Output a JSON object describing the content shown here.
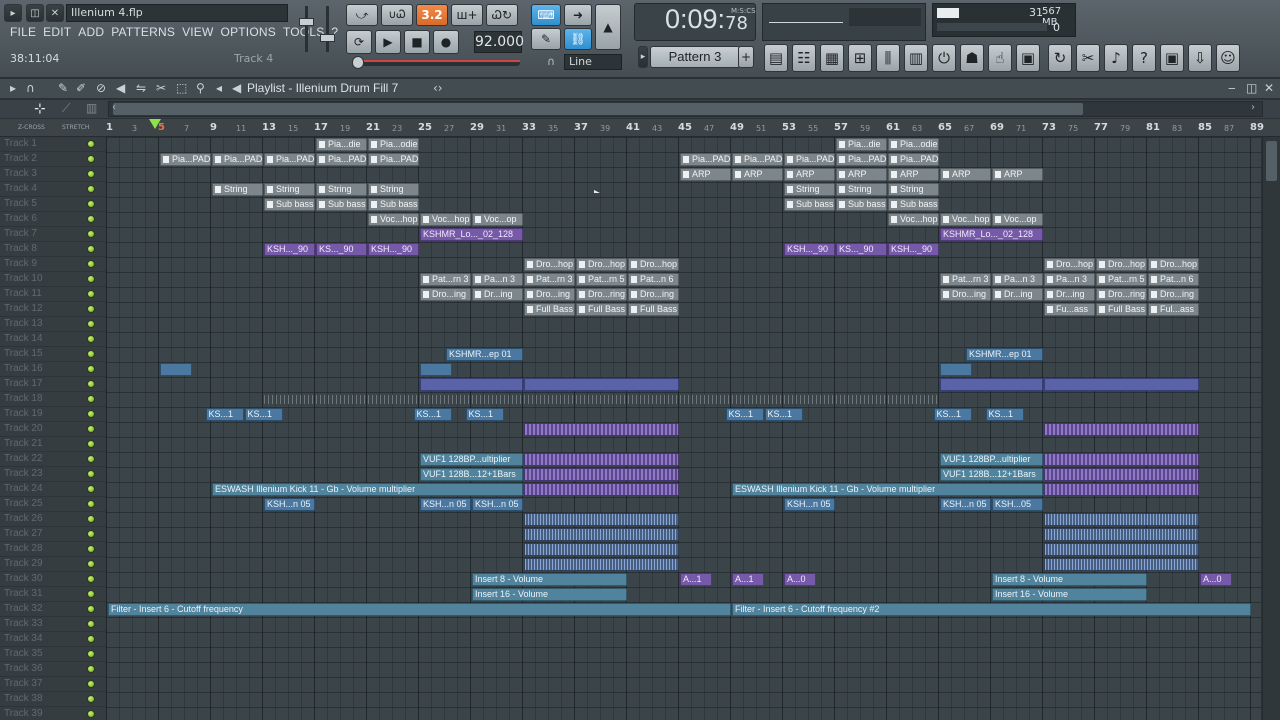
{
  "file_title": "Illenium 4.flp",
  "menu": [
    "FILE",
    "EDIT",
    "ADD",
    "PATTERNS",
    "VIEW",
    "OPTIONS",
    "TOOLS",
    "?"
  ],
  "hint_time": "38:11:04",
  "hint_text": "Track 4",
  "transport": {
    "time_big": "0:09:",
    "time_small": "78",
    "time_unit": "M:S:CS",
    "tempo": "92.000",
    "pattern": "Pattern 3",
    "snap": "Line"
  },
  "cpu": {
    "value": "31",
    "mem": "567 MB",
    "polyphony": "0"
  },
  "playlist": {
    "title": "Playlist - Illenium Drum Fill 7"
  },
  "ruler_labels": [
    "1",
    "3",
    "5",
    "7",
    "9",
    "11",
    "13",
    "15",
    "17",
    "19",
    "21",
    "23",
    "25",
    "27",
    "29",
    "31",
    "33",
    "35",
    "37",
    "39",
    "41",
    "43",
    "45",
    "47",
    "49",
    "51",
    "53",
    "55",
    "57",
    "59",
    "61",
    "63",
    "65",
    "67",
    "69",
    "71",
    "73",
    "75",
    "77",
    "79",
    "81",
    "83",
    "85",
    "87",
    "89"
  ],
  "zcross_label": "Z-CROSS",
  "stretch_label": "STRETCH",
  "tracks": [
    "Track 1",
    "Track 2",
    "Track 3",
    "Track 4",
    "Track 5",
    "Track 6",
    "Track 7",
    "Track 8",
    "Track 9",
    "Track 10",
    "Track 11",
    "Track 12",
    "Track 13",
    "Track 14",
    "Track 15",
    "Track 16",
    "Track 17",
    "Track 18",
    "Track 19",
    "Track 20",
    "Track 21",
    "Track 22",
    "Track 23",
    "Track 24",
    "Track 25",
    "Track 26",
    "Track 27",
    "Track 28",
    "Track 29",
    "Track 30",
    "Track 31",
    "Track 32",
    "Track 33",
    "Track 34",
    "Track 35",
    "Track 36",
    "Track 37",
    "Track 38",
    "Track 39"
  ],
  "clips": [
    {
      "track": 1,
      "bar": 17,
      "len": 4,
      "label": "Pia...die",
      "style": "g"
    },
    {
      "track": 1,
      "bar": 21,
      "len": 4,
      "label": "Pia...odie",
      "style": "g"
    },
    {
      "track": 1,
      "bar": 57,
      "len": 4,
      "label": "Pia...die",
      "style": "g"
    },
    {
      "track": 1,
      "bar": 61,
      "len": 4,
      "label": "Pia...odie",
      "style": "g"
    },
    {
      "track": 2,
      "bar": 5,
      "len": 4,
      "label": "Pia...PAD",
      "style": "g"
    },
    {
      "track": 2,
      "bar": 9,
      "len": 4,
      "label": "Pia...PAD",
      "style": "g"
    },
    {
      "track": 2,
      "bar": 13,
      "len": 4,
      "label": "Pia...PAD",
      "style": "g"
    },
    {
      "track": 2,
      "bar": 17,
      "len": 4,
      "label": "Pia...PAD",
      "style": "g"
    },
    {
      "track": 2,
      "bar": 21,
      "len": 4,
      "label": "Pia...PAD",
      "style": "g"
    },
    {
      "track": 2,
      "bar": 45,
      "len": 4,
      "label": "Pia...PAD",
      "style": "g"
    },
    {
      "track": 2,
      "bar": 49,
      "len": 4,
      "label": "Pia...PAD",
      "style": "g"
    },
    {
      "track": 2,
      "bar": 53,
      "len": 4,
      "label": "Pia...PAD",
      "style": "g"
    },
    {
      "track": 2,
      "bar": 57,
      "len": 4,
      "label": "Pia...PAD",
      "style": "g"
    },
    {
      "track": 2,
      "bar": 61,
      "len": 4,
      "label": "Pia...PAD",
      "style": "g"
    },
    {
      "track": 3,
      "bar": 45,
      "len": 4,
      "label": "ARP",
      "style": "g"
    },
    {
      "track": 3,
      "bar": 49,
      "len": 4,
      "label": "ARP",
      "style": "g"
    },
    {
      "track": 3,
      "bar": 53,
      "len": 4,
      "label": "ARP",
      "style": "g"
    },
    {
      "track": 3,
      "bar": 57,
      "len": 4,
      "label": "ARP",
      "style": "g"
    },
    {
      "track": 3,
      "bar": 61,
      "len": 4,
      "label": "ARP",
      "style": "g"
    },
    {
      "track": 3,
      "bar": 65,
      "len": 4,
      "label": "ARP",
      "style": "g"
    },
    {
      "track": 3,
      "bar": 69,
      "len": 4,
      "label": "ARP",
      "style": "g"
    },
    {
      "track": 4,
      "bar": 9,
      "len": 4,
      "label": "String",
      "style": "g"
    },
    {
      "track": 4,
      "bar": 13,
      "len": 4,
      "label": "String",
      "style": "g"
    },
    {
      "track": 4,
      "bar": 17,
      "len": 4,
      "label": "String",
      "style": "g"
    },
    {
      "track": 4,
      "bar": 21,
      "len": 4,
      "label": "String",
      "style": "g"
    },
    {
      "track": 4,
      "bar": 53,
      "len": 4,
      "label": "String",
      "style": "g"
    },
    {
      "track": 4,
      "bar": 57,
      "len": 4,
      "label": "String",
      "style": "g"
    },
    {
      "track": 4,
      "bar": 61,
      "len": 4,
      "label": "String",
      "style": "g"
    },
    {
      "track": 5,
      "bar": 13,
      "len": 4,
      "label": "Sub bass",
      "style": "g"
    },
    {
      "track": 5,
      "bar": 17,
      "len": 4,
      "label": "Sub bass",
      "style": "g"
    },
    {
      "track": 5,
      "bar": 21,
      "len": 4,
      "label": "Sub bass",
      "style": "g"
    },
    {
      "track": 5,
      "bar": 53,
      "len": 4,
      "label": "Sub bass",
      "style": "g"
    },
    {
      "track": 5,
      "bar": 57,
      "len": 4,
      "label": "Sub bass",
      "style": "g"
    },
    {
      "track": 5,
      "bar": 61,
      "len": 4,
      "label": "Sub bass",
      "style": "g"
    },
    {
      "track": 6,
      "bar": 21,
      "len": 4,
      "label": "Voc...hop",
      "style": "g"
    },
    {
      "track": 6,
      "bar": 25,
      "len": 4,
      "label": "Voc...hop",
      "style": "g"
    },
    {
      "track": 6,
      "bar": 29,
      "len": 4,
      "label": "Voc...op",
      "style": "g"
    },
    {
      "track": 6,
      "bar": 61,
      "len": 4,
      "label": "Voc...hop",
      "style": "g"
    },
    {
      "track": 6,
      "bar": 65,
      "len": 4,
      "label": "Voc...hop",
      "style": "g"
    },
    {
      "track": 6,
      "bar": 69,
      "len": 4,
      "label": "Voc...op",
      "style": "g"
    },
    {
      "track": 7,
      "bar": 25,
      "len": 8,
      "label": "KSHMR_Lo..._02_128",
      "style": "p"
    },
    {
      "track": 7,
      "bar": 65,
      "len": 8,
      "label": "KSHMR_Lo..._02_128",
      "style": "p"
    },
    {
      "track": 8,
      "bar": 13,
      "len": 4,
      "label": "KSH..._90",
      "style": "p"
    },
    {
      "track": 8,
      "bar": 17,
      "len": 4,
      "label": "KS..._90",
      "style": "p"
    },
    {
      "track": 8,
      "bar": 21,
      "len": 4,
      "label": "KSH..._90",
      "style": "p"
    },
    {
      "track": 8,
      "bar": 53,
      "len": 4,
      "label": "KSH..._90",
      "style": "p"
    },
    {
      "track": 8,
      "bar": 57,
      "len": 4,
      "label": "KS..._90",
      "style": "p"
    },
    {
      "track": 8,
      "bar": 61,
      "len": 4,
      "label": "KSH..._90",
      "style": "p"
    },
    {
      "track": 9,
      "bar": 33,
      "len": 4,
      "label": "Dro...hop",
      "style": "g"
    },
    {
      "track": 9,
      "bar": 37,
      "len": 4,
      "label": "Dro...hop",
      "style": "g"
    },
    {
      "track": 9,
      "bar": 41,
      "len": 4,
      "label": "Dro...hop",
      "style": "g"
    },
    {
      "track": 9,
      "bar": 73,
      "len": 4,
      "label": "Dro...hop",
      "style": "g"
    },
    {
      "track": 9,
      "bar": 77,
      "len": 4,
      "label": "Dro...hop",
      "style": "g"
    },
    {
      "track": 9,
      "bar": 81,
      "len": 4,
      "label": "Dro...hop",
      "style": "g"
    },
    {
      "track": 10,
      "bar": 25,
      "len": 4,
      "label": "Pat...rn 3",
      "style": "g"
    },
    {
      "track": 10,
      "bar": 29,
      "len": 4,
      "label": "Pa...n 3",
      "style": "g"
    },
    {
      "track": 10,
      "bar": 33,
      "len": 4,
      "label": "Pat...rn 3",
      "style": "g"
    },
    {
      "track": 10,
      "bar": 37,
      "len": 4,
      "label": "Pat...rn 5",
      "style": "g"
    },
    {
      "track": 10,
      "bar": 41,
      "len": 4,
      "label": "Pat...n 6",
      "style": "g"
    },
    {
      "track": 10,
      "bar": 65,
      "len": 4,
      "label": "Pat...rn 3",
      "style": "g"
    },
    {
      "track": 10,
      "bar": 69,
      "len": 4,
      "label": "Pa...n 3",
      "style": "g"
    },
    {
      "track": 10,
      "bar": 73,
      "len": 4,
      "label": "Pa...n 3",
      "style": "g"
    },
    {
      "track": 10,
      "bar": 77,
      "len": 4,
      "label": "Pat...rn 5",
      "style": "g"
    },
    {
      "track": 10,
      "bar": 81,
      "len": 4,
      "label": "Pat...n 6",
      "style": "g"
    },
    {
      "track": 11,
      "bar": 25,
      "len": 4,
      "label": "Dro...ing",
      "style": "g"
    },
    {
      "track": 11,
      "bar": 29,
      "len": 4,
      "label": "Dr...ing",
      "style": "g"
    },
    {
      "track": 11,
      "bar": 33,
      "len": 4,
      "label": "Dro...ing",
      "style": "g"
    },
    {
      "track": 11,
      "bar": 37,
      "len": 4,
      "label": "Dro...ring",
      "style": "g"
    },
    {
      "track": 11,
      "bar": 41,
      "len": 4,
      "label": "Dro...ing",
      "style": "g"
    },
    {
      "track": 11,
      "bar": 65,
      "len": 4,
      "label": "Dro...ing",
      "style": "g"
    },
    {
      "track": 11,
      "bar": 69,
      "len": 4,
      "label": "Dr...ing",
      "style": "g"
    },
    {
      "track": 11,
      "bar": 73,
      "len": 4,
      "label": "Dr...ing",
      "style": "g"
    },
    {
      "track": 11,
      "bar": 77,
      "len": 4,
      "label": "Dro...ring",
      "style": "g"
    },
    {
      "track": 11,
      "bar": 81,
      "len": 4,
      "label": "Dro...ing",
      "style": "g"
    },
    {
      "track": 12,
      "bar": 33,
      "len": 4,
      "label": "Full Bass",
      "style": "g"
    },
    {
      "track": 12,
      "bar": 37,
      "len": 4,
      "label": "Full Bass",
      "style": "g"
    },
    {
      "track": 12,
      "bar": 41,
      "len": 4,
      "label": "Full Bass",
      "style": "g"
    },
    {
      "track": 12,
      "bar": 73,
      "len": 4,
      "label": "Fu...ass",
      "style": "g"
    },
    {
      "track": 12,
      "bar": 77,
      "len": 4,
      "label": "Full Bass",
      "style": "g"
    },
    {
      "track": 12,
      "bar": 81,
      "len": 4,
      "label": "Ful...ass",
      "style": "g"
    },
    {
      "track": 15,
      "bar": 27,
      "len": 6,
      "label": "KSHMR...ep 01",
      "style": "b"
    },
    {
      "track": 15,
      "bar": 67,
      "len": 6,
      "label": "KSHMR...ep 01",
      "style": "b"
    },
    {
      "track": 16,
      "bar": 5,
      "len": 2.5,
      "label": "",
      "style": "b"
    },
    {
      "track": 16,
      "bar": 25,
      "len": 2.5,
      "label": "",
      "style": "b"
    },
    {
      "track": 16,
      "bar": 65,
      "len": 2.5,
      "label": "",
      "style": "b"
    },
    {
      "track": 17,
      "bar": 25,
      "len": 8,
      "label": "",
      "style": "bp"
    },
    {
      "track": 17,
      "bar": 33,
      "len": 12,
      "label": "",
      "style": "bp"
    },
    {
      "track": 17,
      "bar": 65,
      "len": 8,
      "label": "",
      "style": "bp"
    },
    {
      "track": 17,
      "bar": 73,
      "len": 12,
      "label": "",
      "style": "bp"
    },
    {
      "track": 18,
      "bar": 13,
      "len": 52,
      "label": "",
      "style": "ticks"
    },
    {
      "track": 19,
      "bar": 8.5,
      "len": 3,
      "label": "KS...1",
      "style": "b"
    },
    {
      "track": 19,
      "bar": 11.5,
      "len": 3,
      "label": "KS...1",
      "style": "b"
    },
    {
      "track": 19,
      "bar": 24.5,
      "len": 3,
      "label": "KS...1",
      "style": "b"
    },
    {
      "track": 19,
      "bar": 28.5,
      "len": 3,
      "label": "KS...1",
      "style": "b"
    },
    {
      "track": 19,
      "bar": 48.5,
      "len": 3,
      "label": "KS...1",
      "style": "b"
    },
    {
      "track": 19,
      "bar": 51.5,
      "len": 3,
      "label": "KS...1",
      "style": "b"
    },
    {
      "track": 19,
      "bar": 64.5,
      "len": 3,
      "label": "KS...1",
      "style": "b"
    },
    {
      "track": 19,
      "bar": 68.5,
      "len": 3,
      "label": "KS...1",
      "style": "b"
    },
    {
      "track": 20,
      "bar": 33,
      "len": 12,
      "label": "",
      "style": "dense"
    },
    {
      "track": 20,
      "bar": 73,
      "len": 12,
      "label": "",
      "style": "dense"
    },
    {
      "track": 22,
      "bar": 25,
      "len": 8,
      "label": "VUF1 128BP...ultiplier",
      "style": "a"
    },
    {
      "track": 22,
      "bar": 33,
      "len": 12,
      "label": "",
      "style": "dense"
    },
    {
      "track": 22,
      "bar": 65,
      "len": 8,
      "label": "VUF1 128BP...ultiplier",
      "style": "a"
    },
    {
      "track": 22,
      "bar": 73,
      "len": 12,
      "label": "",
      "style": "dense"
    },
    {
      "track": 23,
      "bar": 25,
      "len": 8,
      "label": "VUF1 128B...12+1Bars",
      "style": "a"
    },
    {
      "track": 23,
      "bar": 33,
      "len": 12,
      "label": "",
      "style": "dense"
    },
    {
      "track": 23,
      "bar": 65,
      "len": 8,
      "label": "VUF1 128B...12+1Bars",
      "style": "a"
    },
    {
      "track": 23,
      "bar": 73,
      "len": 12,
      "label": "",
      "style": "dense"
    },
    {
      "track": 24,
      "bar": 9,
      "len": 24,
      "label": "ESWASH Illenium Kick 11 - Gb - Volume multiplier",
      "style": "a"
    },
    {
      "track": 24,
      "bar": 33,
      "len": 12,
      "label": "",
      "style": "dense"
    },
    {
      "track": 24,
      "bar": 49,
      "len": 24,
      "label": "ESWASH Illenium Kick 11 - Gb - Volume multiplier",
      "style": "a"
    },
    {
      "track": 24,
      "bar": 73,
      "len": 12,
      "label": "",
      "style": "dense"
    },
    {
      "track": 25,
      "bar": 13,
      "len": 4,
      "label": "KSH...n 05",
      "style": "b"
    },
    {
      "track": 25,
      "bar": 25,
      "len": 4,
      "label": "KSH...n 05",
      "style": "b"
    },
    {
      "track": 25,
      "bar": 29,
      "len": 4,
      "label": "KSH...n 05",
      "style": "b"
    },
    {
      "track": 25,
      "bar": 53,
      "len": 4,
      "label": "KSH...n 05",
      "style": "b"
    },
    {
      "track": 25,
      "bar": 65,
      "len": 4,
      "label": "KSH...n 05",
      "style": "b"
    },
    {
      "track": 25,
      "bar": 69,
      "len": 4,
      "label": "KSH...05",
      "style": "b"
    },
    {
      "track": 26,
      "bar": 33,
      "len": 12,
      "label": "",
      "style": "denseb"
    },
    {
      "track": 26,
      "bar": 73,
      "len": 12,
      "label": "",
      "style": "denseb"
    },
    {
      "track": 27,
      "bar": 33,
      "len": 12,
      "label": "",
      "style": "denseb"
    },
    {
      "track": 27,
      "bar": 73,
      "len": 12,
      "label": "",
      "style": "denseb"
    },
    {
      "track": 28,
      "bar": 33,
      "len": 12,
      "label": "",
      "style": "denseb"
    },
    {
      "track": 28,
      "bar": 73,
      "len": 12,
      "label": "",
      "style": "denseb"
    },
    {
      "track": 29,
      "bar": 33,
      "len": 12,
      "label": "",
      "style": "denseb"
    },
    {
      "track": 29,
      "bar": 73,
      "len": 12,
      "label": "",
      "style": "denseb"
    },
    {
      "track": 30,
      "bar": 29,
      "len": 12,
      "label": "Insert 8 - Volume",
      "style": "a"
    },
    {
      "track": 30,
      "bar": 45,
      "len": 2.5,
      "label": "A...1",
      "style": "p"
    },
    {
      "track": 30,
      "bar": 49,
      "len": 2.5,
      "label": "A...1",
      "style": "p"
    },
    {
      "track": 30,
      "bar": 53,
      "len": 2.5,
      "label": "A...0",
      "style": "p"
    },
    {
      "track": 30,
      "bar": 69,
      "len": 12,
      "label": "Insert 8 - Volume",
      "style": "a"
    },
    {
      "track": 30,
      "bar": 85,
      "len": 2.5,
      "label": "A...0",
      "style": "p"
    },
    {
      "track": 31,
      "bar": 29,
      "len": 12,
      "label": "Insert 16 - Volume",
      "style": "a"
    },
    {
      "track": 31,
      "bar": 69,
      "len": 12,
      "label": "Insert 16 - Volume",
      "style": "a"
    },
    {
      "track": 32,
      "bar": 1,
      "len": 48,
      "label": "Filter - Insert 6 - Cutoff frequency",
      "style": "a"
    },
    {
      "track": 32,
      "bar": 49,
      "len": 40,
      "label": "Filter - Insert 6 - Cutoff frequency #2",
      "style": "a"
    }
  ]
}
